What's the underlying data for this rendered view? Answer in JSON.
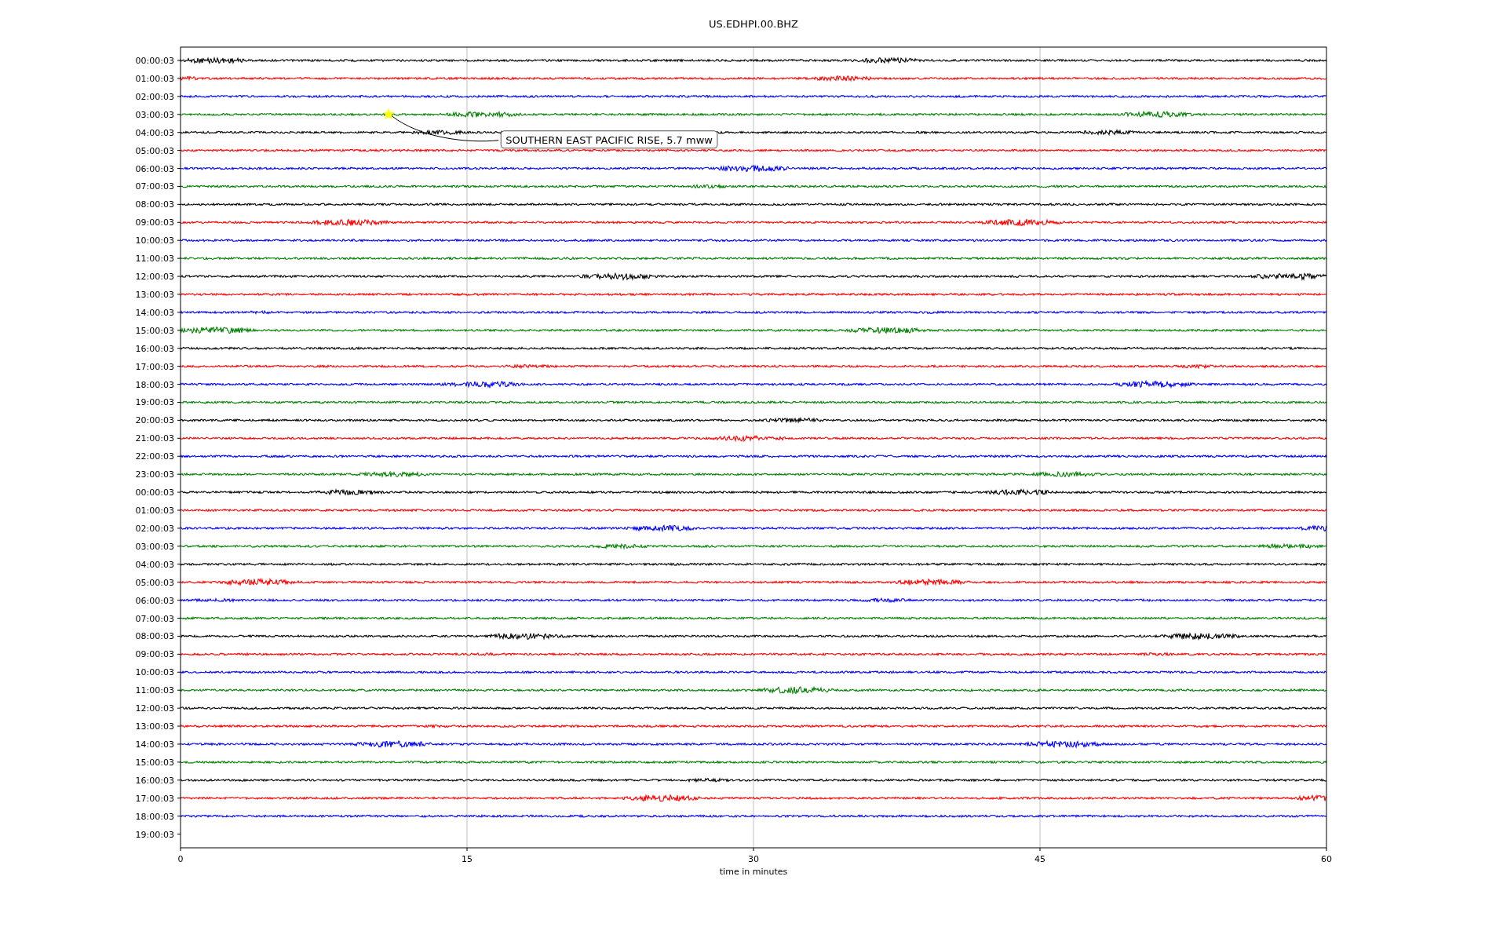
{
  "title": "US.EDHPI.00.BHZ",
  "xlabel": "time in minutes",
  "xticks": [
    "0",
    "15",
    "30",
    "45",
    "60"
  ],
  "rows": [
    {
      "label": "00:00:03",
      "color": "#000000"
    },
    {
      "label": "01:00:03",
      "color": "#ff0000"
    },
    {
      "label": "02:00:03",
      "color": "#0000ff"
    },
    {
      "label": "03:00:03",
      "color": "#008000"
    },
    {
      "label": "04:00:03",
      "color": "#000000"
    },
    {
      "label": "05:00:03",
      "color": "#ff0000"
    },
    {
      "label": "06:00:03",
      "color": "#0000ff"
    },
    {
      "label": "07:00:03",
      "color": "#008000"
    },
    {
      "label": "08:00:03",
      "color": "#000000"
    },
    {
      "label": "09:00:03",
      "color": "#ff0000"
    },
    {
      "label": "10:00:03",
      "color": "#0000ff"
    },
    {
      "label": "11:00:03",
      "color": "#008000"
    },
    {
      "label": "12:00:03",
      "color": "#000000"
    },
    {
      "label": "13:00:03",
      "color": "#ff0000"
    },
    {
      "label": "14:00:03",
      "color": "#0000ff"
    },
    {
      "label": "15:00:03",
      "color": "#008000"
    },
    {
      "label": "16:00:03",
      "color": "#000000"
    },
    {
      "label": "17:00:03",
      "color": "#ff0000"
    },
    {
      "label": "18:00:03",
      "color": "#0000ff"
    },
    {
      "label": "19:00:03",
      "color": "#008000"
    },
    {
      "label": "20:00:03",
      "color": "#000000"
    },
    {
      "label": "21:00:03",
      "color": "#ff0000"
    },
    {
      "label": "22:00:03",
      "color": "#0000ff"
    },
    {
      "label": "23:00:03",
      "color": "#008000"
    },
    {
      "label": "00:00:03",
      "color": "#000000"
    },
    {
      "label": "01:00:03",
      "color": "#ff0000"
    },
    {
      "label": "02:00:03",
      "color": "#0000ff"
    },
    {
      "label": "03:00:03",
      "color": "#008000"
    },
    {
      "label": "04:00:03",
      "color": "#000000"
    },
    {
      "label": "05:00:03",
      "color": "#ff0000"
    },
    {
      "label": "06:00:03",
      "color": "#0000ff"
    },
    {
      "label": "07:00:03",
      "color": "#008000"
    },
    {
      "label": "08:00:03",
      "color": "#000000"
    },
    {
      "label": "09:00:03",
      "color": "#ff0000"
    },
    {
      "label": "10:00:03",
      "color": "#0000ff"
    },
    {
      "label": "11:00:03",
      "color": "#008000"
    },
    {
      "label": "12:00:03",
      "color": "#000000"
    },
    {
      "label": "13:00:03",
      "color": "#ff0000"
    },
    {
      "label": "14:00:03",
      "color": "#0000ff"
    },
    {
      "label": "15:00:03",
      "color": "#008000"
    },
    {
      "label": "16:00:03",
      "color": "#000000"
    },
    {
      "label": "17:00:03",
      "color": "#ff0000"
    },
    {
      "label": "18:00:03",
      "color": "#0000ff"
    },
    {
      "label": "19:00:03"
    }
  ],
  "event": {
    "label": "SOUTHERN EAST PACIFIC RISE, 5.7 mww"
  }
}
